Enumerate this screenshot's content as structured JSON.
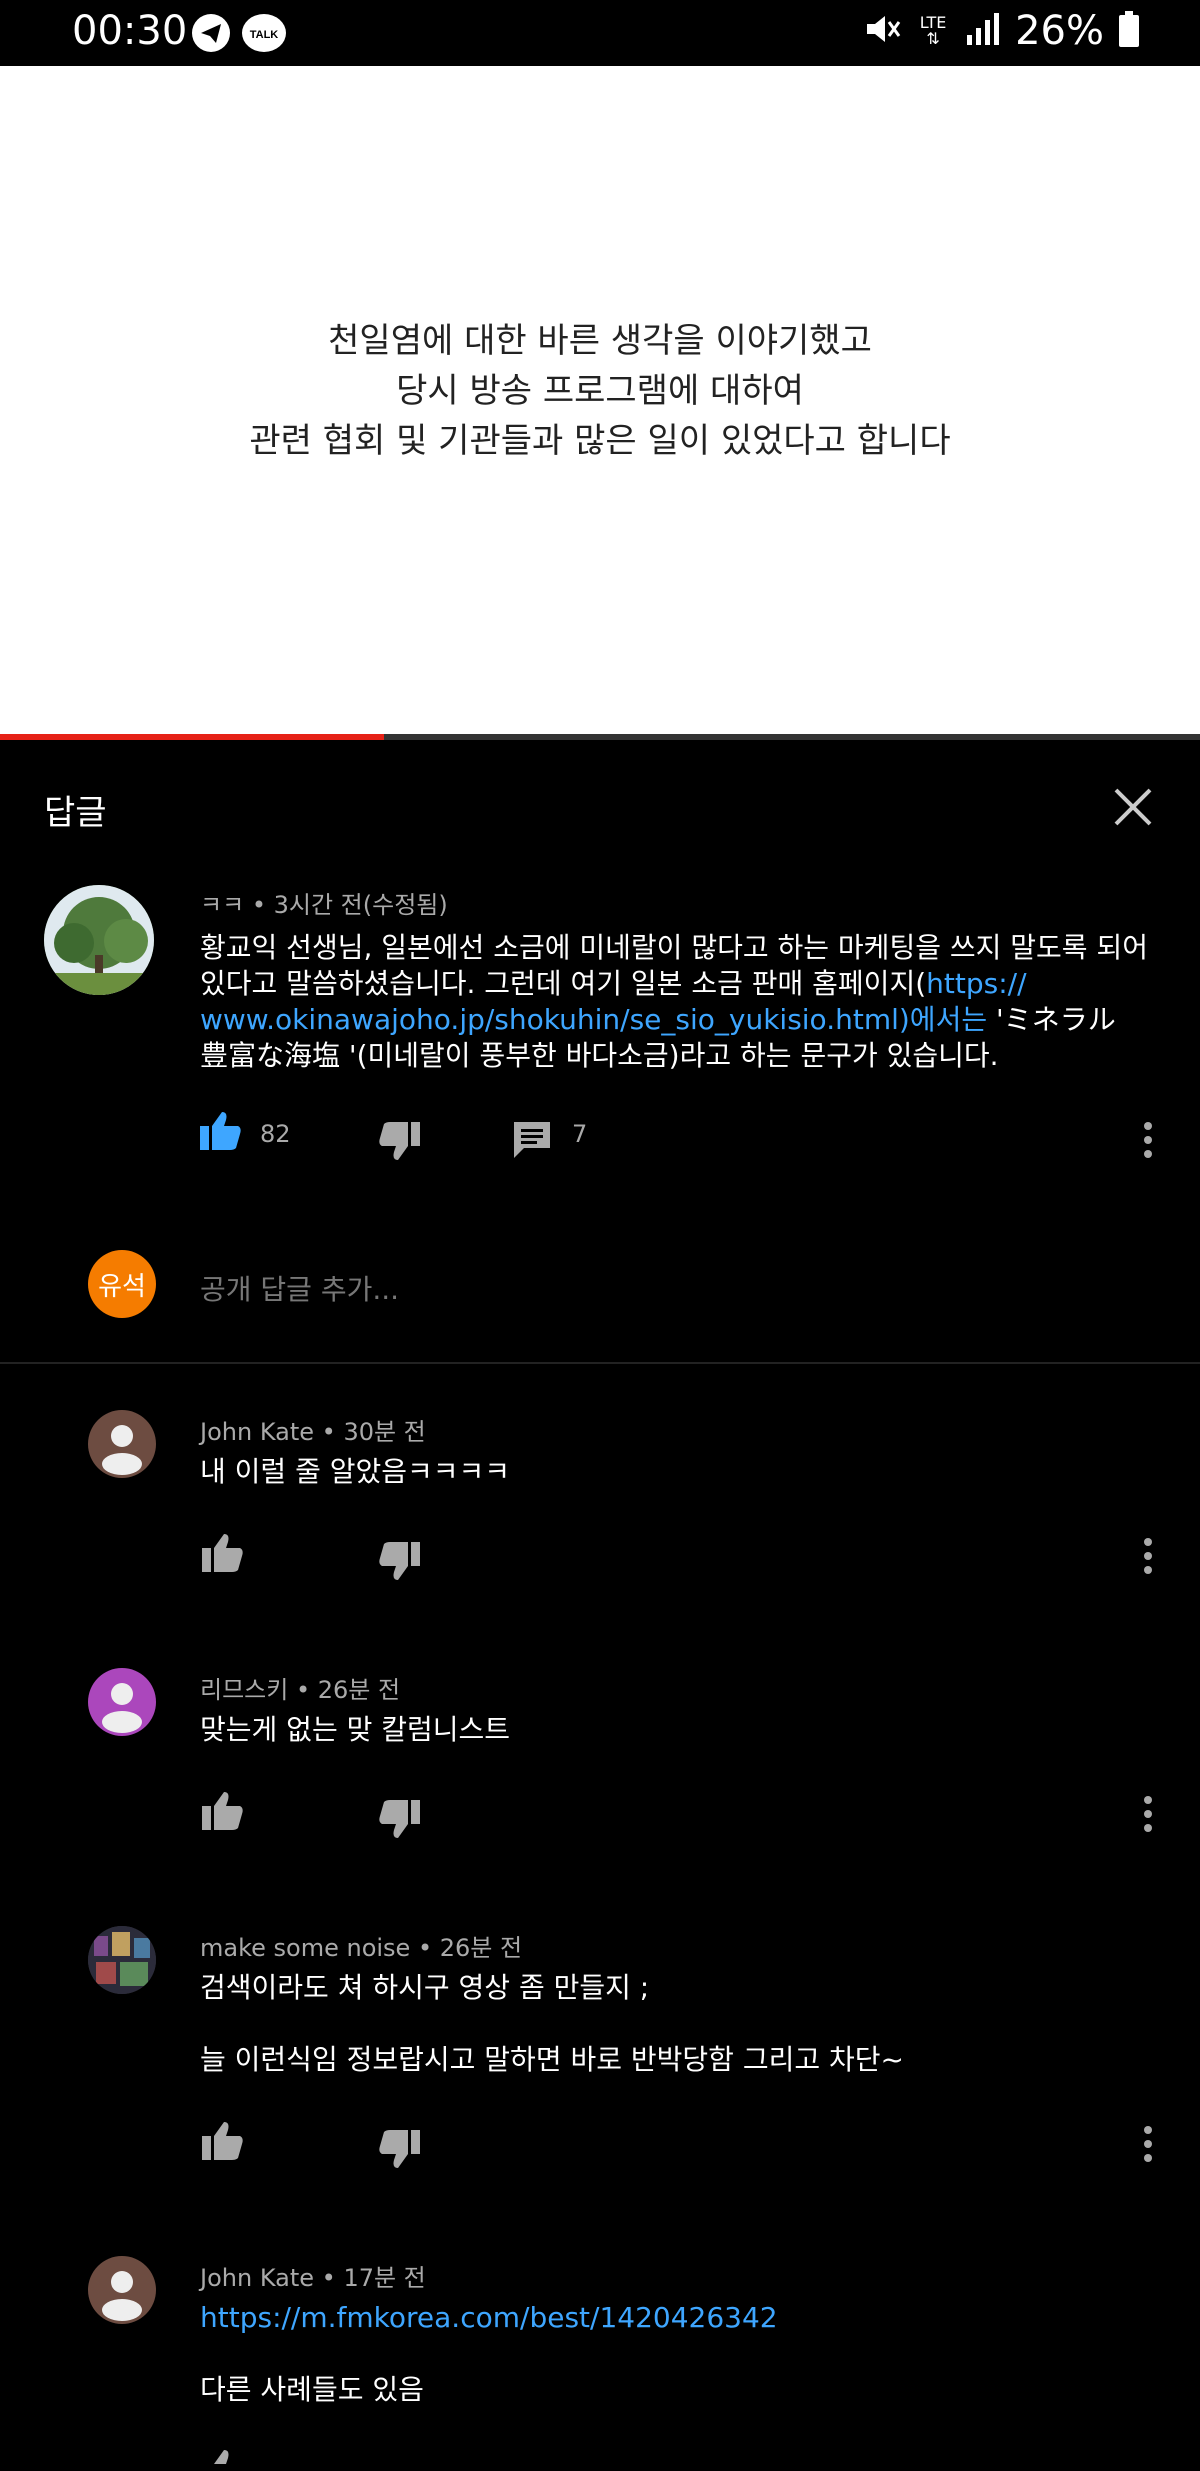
{
  "status_bar": {
    "time": "00:30",
    "battery": "26%",
    "network": "LTE",
    "icons": [
      "telegram-icon",
      "kakaotalk-icon",
      "mute-icon",
      "lte-icon",
      "signal-icon",
      "battery-icon"
    ]
  },
  "video": {
    "caption_lines": [
      "천일염에 대한 바른 생각을 이야기했고",
      "당시 방송 프로그램에 대하여",
      "관련 협회 및 기관들과 많은 일이 있었다고 합니다"
    ],
    "progress": 0.32
  },
  "replies_panel": {
    "title": "답글",
    "main_comment": {
      "author": "ㅋㅋ",
      "time": "3시간 전(수정됨)",
      "text_1": "황교익 선생님, 일본에선 소금에 미네랄이 많다고 하는 마케팅을 쓰지 말도록 되어",
      "text_2": "있다고 말씀하셨습니다.  그런데 여기 일본 소금 판매 홈페이지(",
      "link_part1": "https://",
      "link_part2": "www.okinawajoho.jp/shokuhin/se_sio_yukisio.html)에서는",
      "text_3": " 'ミネラル",
      "text_4": "豊富な海塩 '(미네랄이 풍부한 바다소금)라고 하는 문구가 있습니다.",
      "likes": "82",
      "reply_count": "7"
    },
    "reply_box": {
      "avatar_label": "유석",
      "placeholder": "공개 답글 추가..."
    },
    "replies": [
      {
        "author": "John Kate",
        "time": "30분 전",
        "text": "내 이럴 줄 알았음ㅋㅋㅋㅋ"
      },
      {
        "author": "리므스키",
        "time": "26분 전",
        "text": "맞는게 없는 맞 칼럼니스트"
      },
      {
        "author": "make some noise",
        "time": "26분 전",
        "text": "검색이라도 쳐 하시구 영상  좀 만들지 ;",
        "text_2": "늘 이런식임 정보랍시고 말하면 바로 반박당함 그리고 차단~"
      },
      {
        "author": "John Kate",
        "time": "17분 전",
        "link": "https://m.fmkorea.com/best/1420426342",
        "text": "다른 사례들도 있음"
      }
    ]
  },
  "colors": {
    "background": "#000000",
    "link": "#3ea6ff",
    "like_active": "#3ea6ff",
    "progress": "#e62117",
    "muted": "#aaaaaa",
    "reply_avatar": "#f57c00",
    "avatar_brown": "#6d4c41",
    "avatar_purple": "#ab47bc"
  }
}
